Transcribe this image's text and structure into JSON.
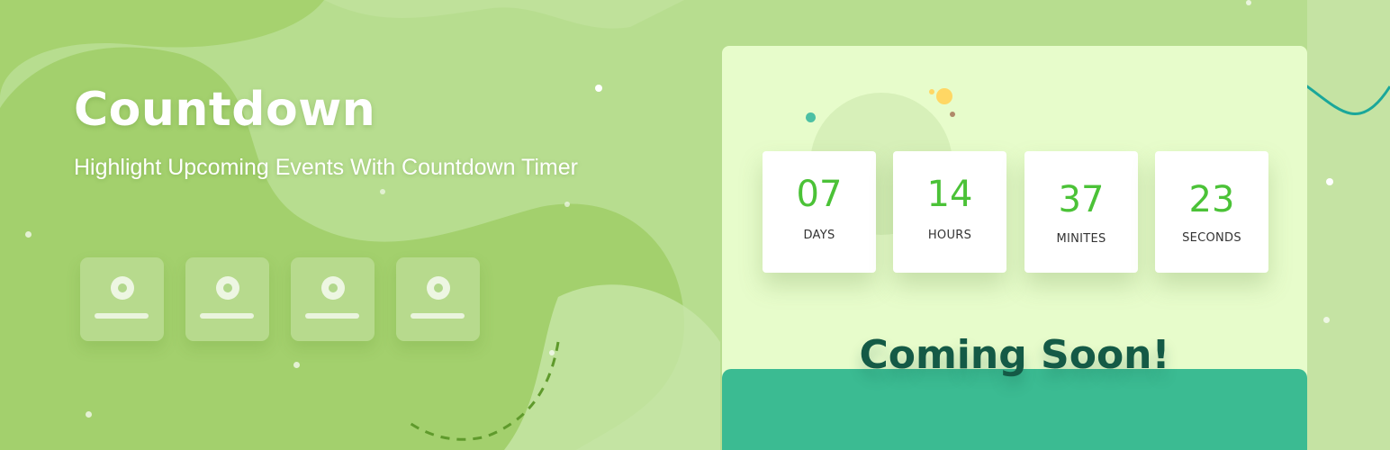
{
  "hero": {
    "title": "Countdown",
    "subtitle": "Highlight Upcoming Events With Countdown Timer"
  },
  "placeholder_boxes_count": 4,
  "timer": [
    {
      "value": "07",
      "label": "DAYS"
    },
    {
      "value": "14",
      "label": "HOURS"
    },
    {
      "value": "37",
      "label": "MINITES"
    },
    {
      "value": "23",
      "label": "SECONDS"
    }
  ],
  "panel": {
    "headline": "Coming Soon!"
  },
  "colors": {
    "background": "#b4dc8a",
    "panel": "#e7fccb",
    "accent_green": "#4bc237",
    "footer_teal": "#3bbb92",
    "headline": "#145a46"
  },
  "icons": {
    "placeholder": "avatar-circle-icon",
    "decor": "confetti-dots-icon"
  }
}
